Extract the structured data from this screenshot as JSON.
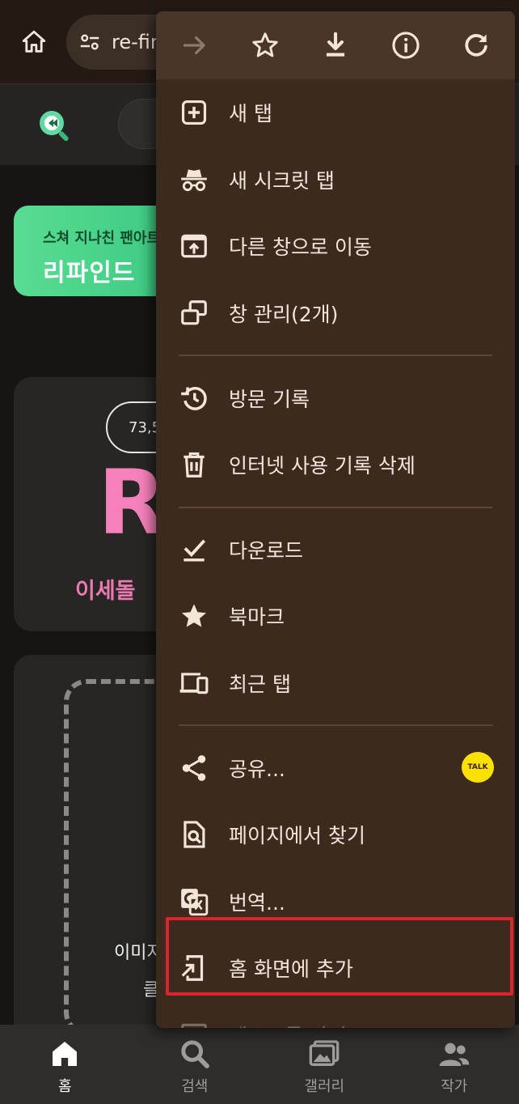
{
  "browser": {
    "url_text": "re-find.xyz"
  },
  "page": {
    "banner_subtitle": "스쳐 지나친 팬아트",
    "banner_title": "리파인드",
    "counter_pill": "73,5",
    "big_letter": "R",
    "tagline": "이세돌",
    "drop_line1": "이미지",
    "drop_line2": "클릭"
  },
  "menu": {
    "groups": [
      [
        {
          "label": "새 탭",
          "icon": "add-box-icon"
        },
        {
          "label": "새 시크릿 탭",
          "icon": "incognito-icon"
        },
        {
          "label": "다른 창으로 이동",
          "icon": "move-window-icon"
        },
        {
          "label": "창 관리(2개)",
          "icon": "manage-windows-icon"
        }
      ],
      [
        {
          "label": "방문 기록",
          "icon": "history-icon"
        },
        {
          "label": "인터넷 사용 기록 삭제",
          "icon": "trash-icon"
        }
      ],
      [
        {
          "label": "다운로드",
          "icon": "download-done-icon"
        },
        {
          "label": "북마크",
          "icon": "star-filled-icon"
        },
        {
          "label": "최근 탭",
          "icon": "devices-icon"
        }
      ],
      [
        {
          "label": "공유...",
          "icon": "share-icon",
          "badge": "TALK"
        },
        {
          "label": "페이지에서 찾기",
          "icon": "find-in-page-icon"
        },
        {
          "label": "번역...",
          "icon": "translate-icon"
        },
        {
          "label": "홈 화면에 추가",
          "icon": "add-to-home-icon",
          "highlighted": true
        },
        {
          "label": "데스크톱 사이트",
          "icon": "desktop-icon"
        }
      ]
    ]
  },
  "bottom_nav": [
    {
      "label": "홈",
      "icon": "home-icon",
      "active": true
    },
    {
      "label": "검색",
      "icon": "search-icon"
    },
    {
      "label": "갤러리",
      "icon": "gallery-icon"
    },
    {
      "label": "작가",
      "icon": "people-icon"
    }
  ],
  "colors": {
    "menu_bg": "#3c2a1f",
    "menu_header_bg": "#4a3628",
    "highlight_border": "#d9252b",
    "brand_pink": "#f481ba",
    "brand_green": "#3ccf86",
    "kakao_yellow": "#fae100"
  }
}
